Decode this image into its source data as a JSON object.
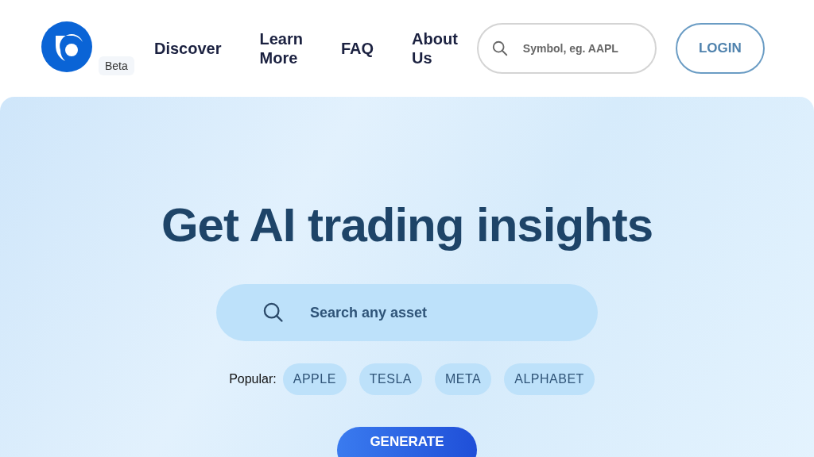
{
  "header": {
    "badge": "Beta",
    "nav": [
      {
        "label": "Discover"
      },
      {
        "label": "Learn More"
      },
      {
        "label": "FAQ"
      },
      {
        "label": "About Us"
      }
    ],
    "search": {
      "placeholder": "Symbol, eg. AAPL"
    },
    "login": "LOGIN"
  },
  "hero": {
    "title": "Get AI trading insights",
    "search": {
      "placeholder": "Search any asset"
    },
    "popular_label": "Popular:",
    "popular": [
      "APPLE",
      "TESLA",
      "META",
      "ALPHABET"
    ],
    "button": "GENERATE"
  }
}
